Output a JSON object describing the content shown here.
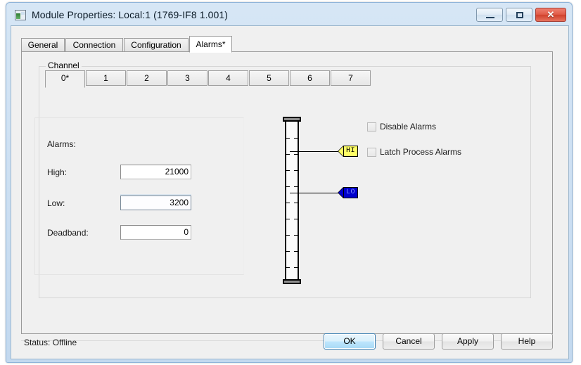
{
  "window": {
    "title": "Module Properties: Local:1 (1769-IF8 1.001)",
    "icon": "module-icon",
    "controls": {
      "minimize": "minimize-icon",
      "maximize": "maximize-icon",
      "close": "✕"
    }
  },
  "tabs": [
    {
      "label": "General",
      "active": false
    },
    {
      "label": "Connection",
      "active": false
    },
    {
      "label": "Configuration",
      "active": false
    },
    {
      "label": "Alarms*",
      "active": true
    }
  ],
  "channel_group": {
    "label": "Channel",
    "tabs": [
      {
        "label": "0*",
        "active": true
      },
      {
        "label": "1",
        "active": false
      },
      {
        "label": "2",
        "active": false
      },
      {
        "label": "3",
        "active": false
      },
      {
        "label": "4",
        "active": false
      },
      {
        "label": "5",
        "active": false
      },
      {
        "label": "6",
        "active": false
      },
      {
        "label": "7",
        "active": false
      }
    ]
  },
  "alarms": {
    "section_label": "Alarms:",
    "high": {
      "label": "High:",
      "value": "21000"
    },
    "low": {
      "label": "Low:",
      "value": "3200"
    },
    "deadband": {
      "label": "Deadband:",
      "value": "0"
    }
  },
  "gauge": {
    "markers": [
      {
        "id": "hi",
        "label": "HI",
        "color": "#ffff66",
        "text_color": "#000000"
      },
      {
        "id": "lo",
        "label": "LO",
        "color": "#0000cc",
        "text_color": "#7f8cff"
      }
    ],
    "tick_count": 10
  },
  "options": [
    {
      "label": "Disable Alarms",
      "checked": false
    },
    {
      "label": "Latch Process Alarms",
      "checked": false
    }
  ],
  "statusbar": {
    "status": "Status:  Offline",
    "buttons": [
      {
        "label": "OK",
        "default": true
      },
      {
        "label": "Cancel",
        "default": false
      },
      {
        "label": "Apply",
        "default": false
      },
      {
        "label": "Help",
        "default": false
      }
    ]
  }
}
